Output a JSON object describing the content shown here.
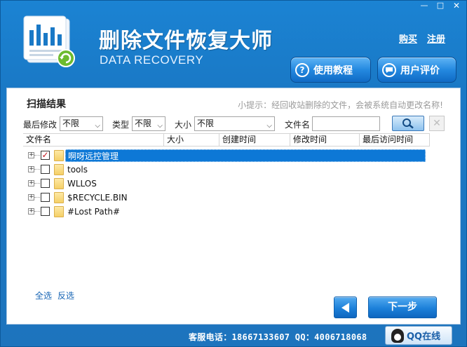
{
  "window": {
    "title": "删除文件恢复大师",
    "subtitle": "DATA RECOVERY",
    "controls": {
      "minimize": "—",
      "restore": "□",
      "close": "✕"
    }
  },
  "top_links": {
    "purchase": "购买",
    "register": "注册"
  },
  "header_buttons": {
    "help": "使用教程",
    "feedback": "用户评价"
  },
  "panel": {
    "title": "扫描结果",
    "tip": "小提示：经回收站删除的文件，会被系统自动更改名称!"
  },
  "filters": {
    "last_modified_label": "最后修改",
    "last_modified_value": "不限",
    "type_label": "类型",
    "type_value": "不限",
    "size_label": "大小",
    "size_value": "不限",
    "filename_label": "文件名",
    "filename_value": ""
  },
  "grid": {
    "columns": [
      "文件名",
      "大小",
      "创建时间",
      "修改时间",
      "最后访问时间"
    ],
    "rows": [
      {
        "name": "啊呀远控管理",
        "checked": true,
        "selected": true
      },
      {
        "name": "tools",
        "checked": false,
        "selected": false
      },
      {
        "name": "WLLOS",
        "checked": false,
        "selected": false
      },
      {
        "name": "$RECYCLE.BIN",
        "checked": false,
        "selected": false
      },
      {
        "name": "#Lost Path#",
        "checked": false,
        "selected": false
      }
    ]
  },
  "selection_links": {
    "select_all": "全选",
    "invert": "反选"
  },
  "navigation": {
    "next": "下一步"
  },
  "footer": {
    "contact": "客服电话：18667133607  QQ：4006718068",
    "qq_button": "QQ在线"
  },
  "colors": {
    "accent": "#1a79c6",
    "selection": "#0d78d6",
    "check": "#c4131b"
  }
}
